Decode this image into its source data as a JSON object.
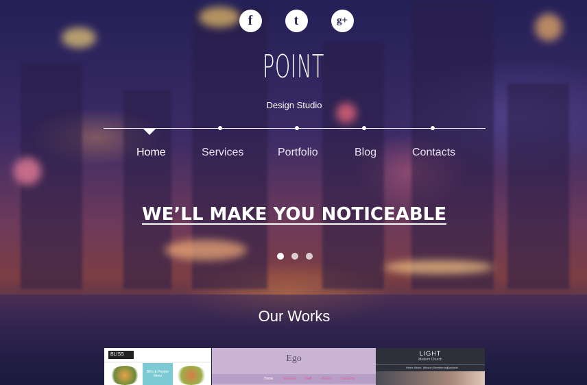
{
  "social": [
    {
      "name": "facebook-icon",
      "glyph": "f"
    },
    {
      "name": "tumblr-icon",
      "glyph": "t"
    },
    {
      "name": "google-plus-icon",
      "glyph": "g+"
    }
  ],
  "brand": {
    "logo": "POINT",
    "tagline": "Design Studio"
  },
  "nav": [
    {
      "label": "Home",
      "active": true
    },
    {
      "label": "Services"
    },
    {
      "label": "Portfolio"
    },
    {
      "label": "Blog"
    },
    {
      "label": "Contacts"
    }
  ],
  "hero": {
    "headline": "WE’LL MAKE YOU NOTICEABLE"
  },
  "slider": {
    "count": 3,
    "active": 0
  },
  "works": {
    "title": "Our Works",
    "items": [
      {
        "name": "BLISS",
        "caption": "Bill's & Pepper Menu"
      },
      {
        "name": "Ego",
        "menu": [
          "Home",
          "Services",
          "Staff",
          "Prices",
          "Contacts"
        ]
      },
      {
        "name": "LIGHT",
        "subtitle": "Modern Church",
        "menu": [
          "Home",
          "About",
          "Mission",
          "Membership",
          "Contacts"
        ]
      }
    ]
  },
  "colors": {
    "accent": "#ffffff",
    "thumb_ego": "#c9b4d3",
    "thumb_light": "#2d2f3a"
  }
}
